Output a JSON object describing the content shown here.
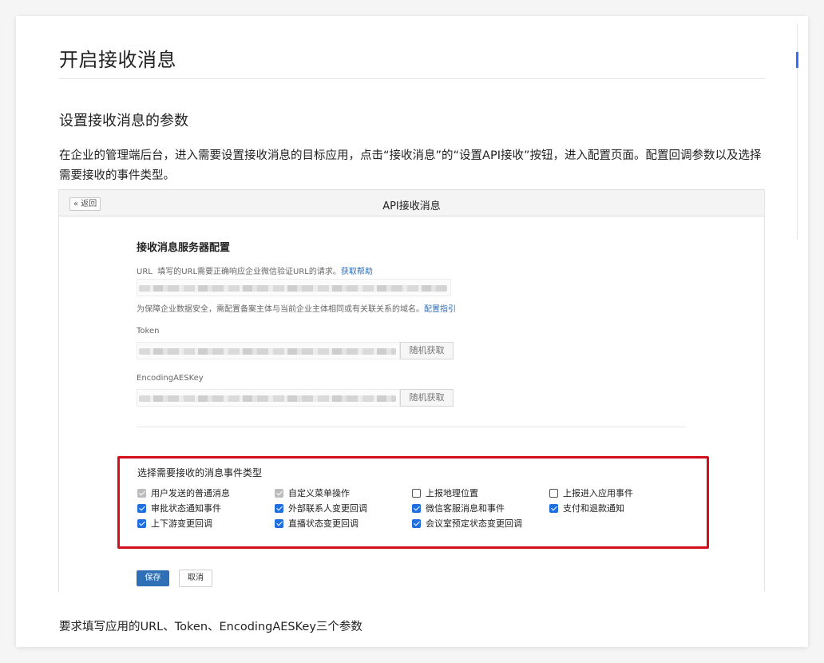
{
  "page": {
    "title": "开启接收消息",
    "section_title": "设置接收消息的参数",
    "description": "在企业的管理端后台，进入需要设置接收消息的目标应用，点击“接收消息”的“设置API接收”按钮，进入配置页面。配置回调参数以及选择需要接收的事件类型。",
    "caption": "要求填写应用的URL、Token、EncodingAESKey三个参数"
  },
  "screenshot": {
    "back_label": "« 返回",
    "header_title": "API接收消息",
    "config_heading": "接收消息服务器配置",
    "url": {
      "label": "URL",
      "hint": "填写的URL需要正确响应企业微信验证URL的请求。",
      "hint_link": "获取帮助",
      "value": "",
      "note": "为保障企业数据安全，需配置备案主体与当前企业主体相同或有关联关系的域名。",
      "note_link": "配置指引"
    },
    "token": {
      "label": "Token",
      "value": "",
      "button": "随机获取"
    },
    "aeskey": {
      "label": "EncodingAESKey",
      "value": "",
      "button": "随机获取"
    },
    "events": {
      "title": "选择需要接收的消息事件类型",
      "items": [
        {
          "label": "用户发送的普通消息",
          "state": "disabled"
        },
        {
          "label": "自定义菜单操作",
          "state": "disabled"
        },
        {
          "label": "上报地理位置",
          "state": "unchecked"
        },
        {
          "label": "上报进入应用事件",
          "state": "unchecked"
        },
        {
          "label": "审批状态通知事件",
          "state": "checked"
        },
        {
          "label": "外部联系人变更回调",
          "state": "checked"
        },
        {
          "label": "微信客服消息和事件",
          "state": "checked"
        },
        {
          "label": "支付和退款通知",
          "state": "checked"
        },
        {
          "label": "上下游变更回调",
          "state": "checked"
        },
        {
          "label": "直播状态变更回调",
          "state": "checked"
        },
        {
          "label": "会议室预定状态变更回调",
          "state": "checked"
        }
      ]
    },
    "save_label": "保存",
    "cancel_label": "取消"
  },
  "colors": {
    "accent": "#1f6fe0",
    "highlight_border": "#d20f1c",
    "save_button": "#2f6fb6",
    "scrollbar_thumb": "#3370ff"
  }
}
